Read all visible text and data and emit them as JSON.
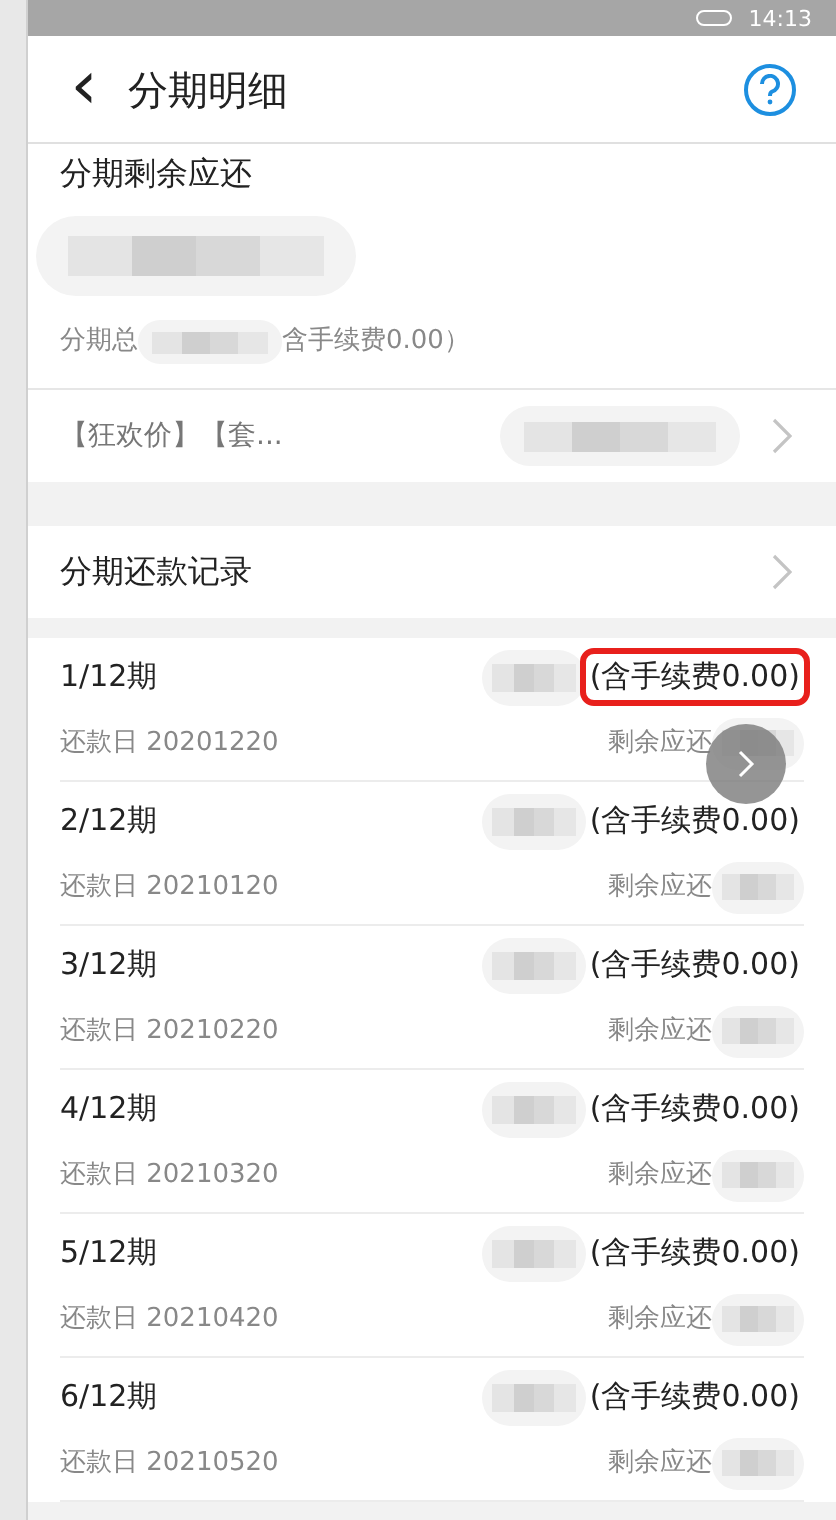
{
  "status_bar": {
    "time": "14:13"
  },
  "header": {
    "title": "分期明细",
    "back": "‹"
  },
  "summary": {
    "label": "分期剩余应还",
    "total_prefix": "分期总",
    "total_suffix": "含手续费0.00）"
  },
  "product": {
    "text": "【狂欢价】【套..."
  },
  "records_link": {
    "label": "分期还款记录"
  },
  "installments": [
    {
      "period": "1/12期",
      "date": "还款日 20201220",
      "fee": "(含手续费0.00)",
      "remaining": "剩余应还",
      "highlighted": true
    },
    {
      "period": "2/12期",
      "date": "还款日 20210120",
      "fee": "(含手续费0.00)",
      "remaining": "剩余应还",
      "highlighted": false
    },
    {
      "period": "3/12期",
      "date": "还款日 20210220",
      "fee": "(含手续费0.00)",
      "remaining": "剩余应还",
      "highlighted": false
    },
    {
      "period": "4/12期",
      "date": "还款日 20210320",
      "fee": "(含手续费0.00)",
      "remaining": "剩余应还",
      "highlighted": false
    },
    {
      "period": "5/12期",
      "date": "还款日 20210420",
      "fee": "(含手续费0.00)",
      "remaining": "剩余应还",
      "highlighted": false
    },
    {
      "period": "6/12期",
      "date": "还款日 20210520",
      "fee": "(含手续费0.00)",
      "remaining": "剩余应还",
      "highlighted": false
    }
  ]
}
